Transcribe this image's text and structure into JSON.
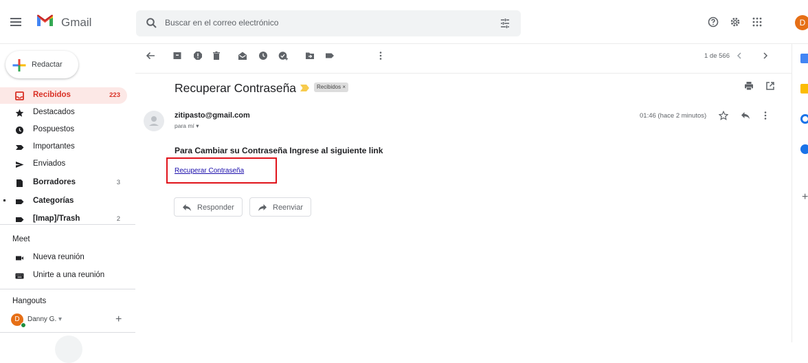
{
  "app": {
    "brand": "Gmail"
  },
  "search": {
    "placeholder": "Buscar en el correo electrónico"
  },
  "account": {
    "initial": "D"
  },
  "compose": {
    "label": "Redactar"
  },
  "nav": [
    {
      "label": "Recibidos",
      "count": "223",
      "icon": "inbox-icon",
      "selected": true
    },
    {
      "label": "Destacados",
      "count": "",
      "icon": "star-icon"
    },
    {
      "label": "Pospuestos",
      "count": "",
      "icon": "clock-icon"
    },
    {
      "label": "Importantes",
      "count": "",
      "icon": "important-icon"
    },
    {
      "label": "Enviados",
      "count": "",
      "icon": "send-icon"
    },
    {
      "label": "Borradores",
      "count": "3",
      "icon": "draft-icon"
    },
    {
      "label": "Categorías",
      "count": "",
      "icon": "label-icon"
    },
    {
      "label": "[Imap]/Trash",
      "count": "2",
      "icon": "label-icon"
    }
  ],
  "meet": {
    "title": "Meet",
    "items": [
      {
        "label": "Nueva reunión",
        "icon": "video-icon"
      },
      {
        "label": "Unirte a una reunión",
        "icon": "keyboard-icon"
      }
    ]
  },
  "hangouts": {
    "title": "Hangouts",
    "user": "Danny G.",
    "initial": "D"
  },
  "pager": {
    "text": "1 de 566"
  },
  "message": {
    "subject": "Recuperar Contraseña",
    "label_chip": "Recibidos ×",
    "sender": "zitipasto@gmail.com",
    "to": "para mí",
    "time": "01:46 (hace 2 minutos)",
    "body_heading": "Para Cambiar su Contraseña Ingrese al siguiente link",
    "link_text": "Recuperar Contraseña"
  },
  "actions": {
    "reply": "Responder",
    "forward": "Reenviar"
  },
  "colors": {
    "accent_red": "#d93025",
    "selected_bg": "#fce8e6",
    "link": "#1a0dab",
    "highlight_box": "#e0121a"
  }
}
